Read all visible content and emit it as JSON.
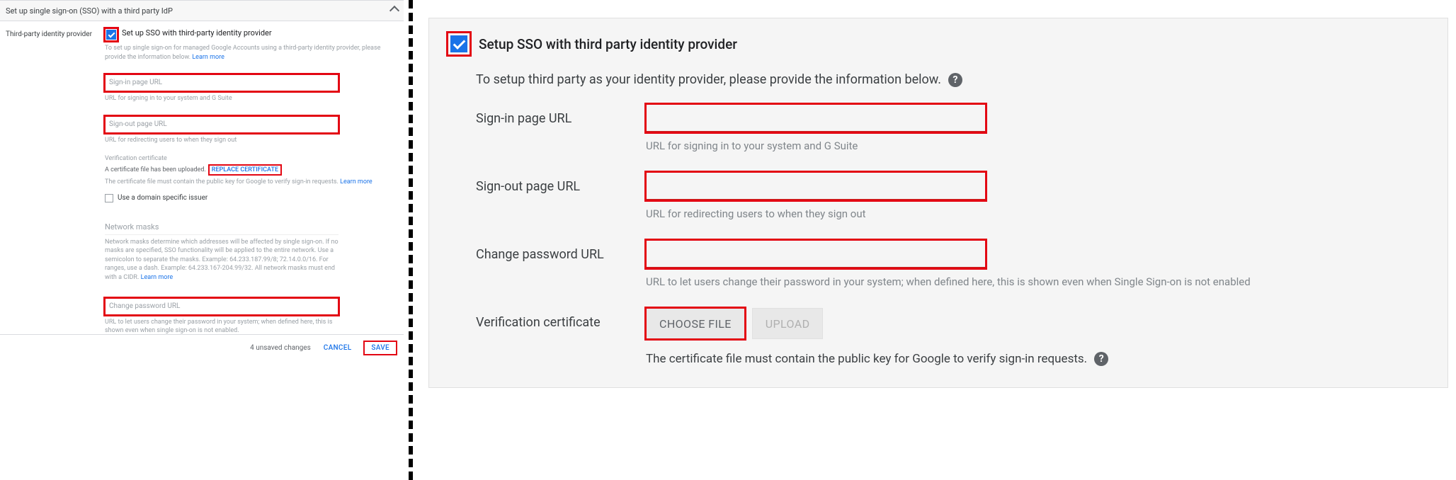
{
  "left": {
    "header": "Set up single sign-on (SSO) with a third party IdP",
    "side_label": "Third-party identity provider",
    "checkbox_label": "Set up SSO with third-party identity provider",
    "intro": "To set up single sign-on for managed Google Accounts using a third-party identity provider, please provide the information below.",
    "learn_more": "Learn more",
    "signin_placeholder": "Sign-in page URL",
    "signin_help": "URL for signing in to your system and G Suite",
    "signout_placeholder": "Sign-out page URL",
    "signout_help": "URL for redirecting users to when they sign out",
    "cert_title": "Verification certificate",
    "cert_uploaded": "A certificate file has been uploaded.",
    "replace_btn": "REPLACE CERTIFICATE",
    "cert_help": "The certificate file must contain the public key for Google to verify sign-in requests.",
    "domain_issuer": "Use a domain specific issuer",
    "nm_title": "Network masks",
    "nm_help": "Network masks determine which addresses will be affected by single sign-on. If no masks are specified, SSO functionality will be applied to the entire network. Use a semicolon to separate the masks. Example: 64.233.187.99/8; 72.14.0.0/16. For ranges, use a dash. Example: 64.233.167-204.99/32. All network masks must end with a CIDR.",
    "change_pw_placeholder": "Change password URL",
    "change_pw_help": "URL to let users change their password in your system; when defined here, this is shown even when single sign-on is not enabled.",
    "unsaved": "4 unsaved changes",
    "cancel": "CANCEL",
    "save": "SAVE"
  },
  "right": {
    "title": "Setup SSO with third party identity provider",
    "subtitle": "To setup third party as your identity provider, please provide the information below.",
    "signin_label": "Sign-in page URL",
    "signin_help": "URL for signing in to your system and G Suite",
    "signout_label": "Sign-out page URL",
    "signout_help": "URL for redirecting users to when they sign out",
    "change_pw_label": "Change password URL",
    "change_pw_help": "URL to let users change their password in your system; when defined here, this is shown even when Single Sign-on is not enabled",
    "cert_label": "Verification certificate",
    "choose_file": "CHOOSE FILE",
    "upload": "UPLOAD",
    "cert_note": "The certificate file must contain the public key for Google to verify sign-in requests.",
    "help_q": "?"
  }
}
